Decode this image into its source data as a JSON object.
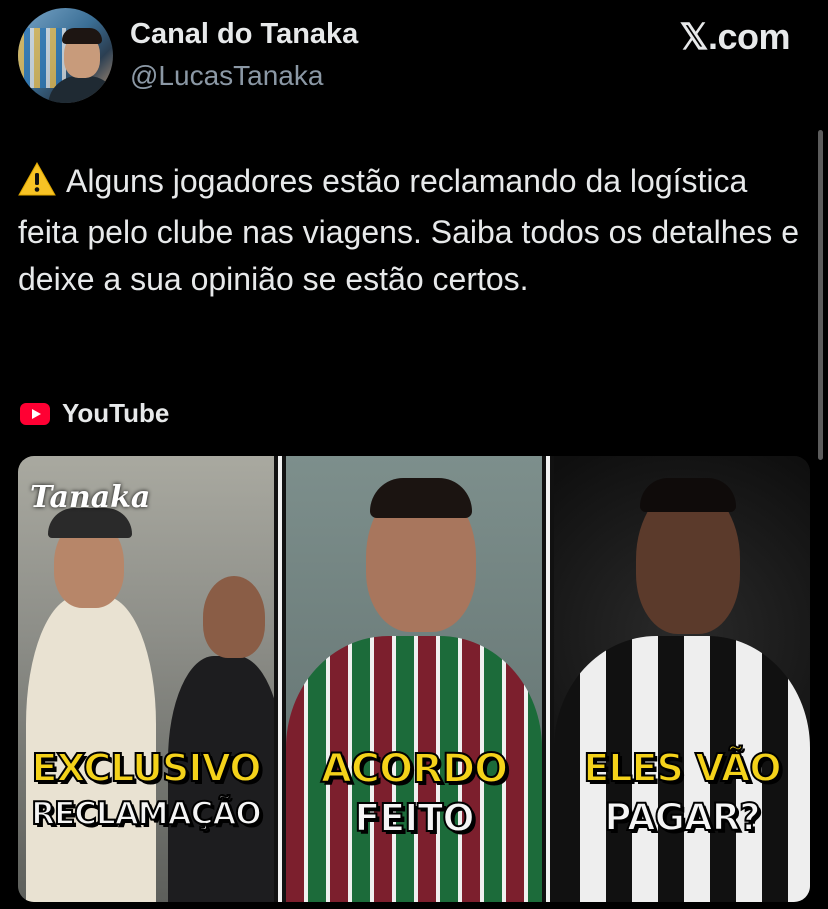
{
  "author": {
    "display_name": "Canal do Tanaka",
    "handle": "@LucasTanaka"
  },
  "platform_logo": "𝕏.com",
  "tweet": {
    "warning_icon": "warning-triangle",
    "text": "Alguns jogadores estão reclamando da logística feita pelo clube nas viagens. Saiba todos os detalhes e deixe a sua opinião se estão certos."
  },
  "source": {
    "icon": "youtube-icon",
    "label": "YouTube"
  },
  "thumbnail": {
    "brand": "Tanaka",
    "panels": [
      {
        "line1": "EXCLUSIVO",
        "line2": "RECLAMAÇÃO"
      },
      {
        "line1": "ACORDO",
        "line2": "FEITO"
      },
      {
        "line1": "ELES VÃO",
        "line2": "PAGAR?"
      }
    ]
  },
  "colors": {
    "background": "#000000",
    "text": "#e7e9ea",
    "secondary_text": "#8b98a5",
    "caption_yellow": "#f4d21a",
    "youtube_red": "#ff0033"
  }
}
